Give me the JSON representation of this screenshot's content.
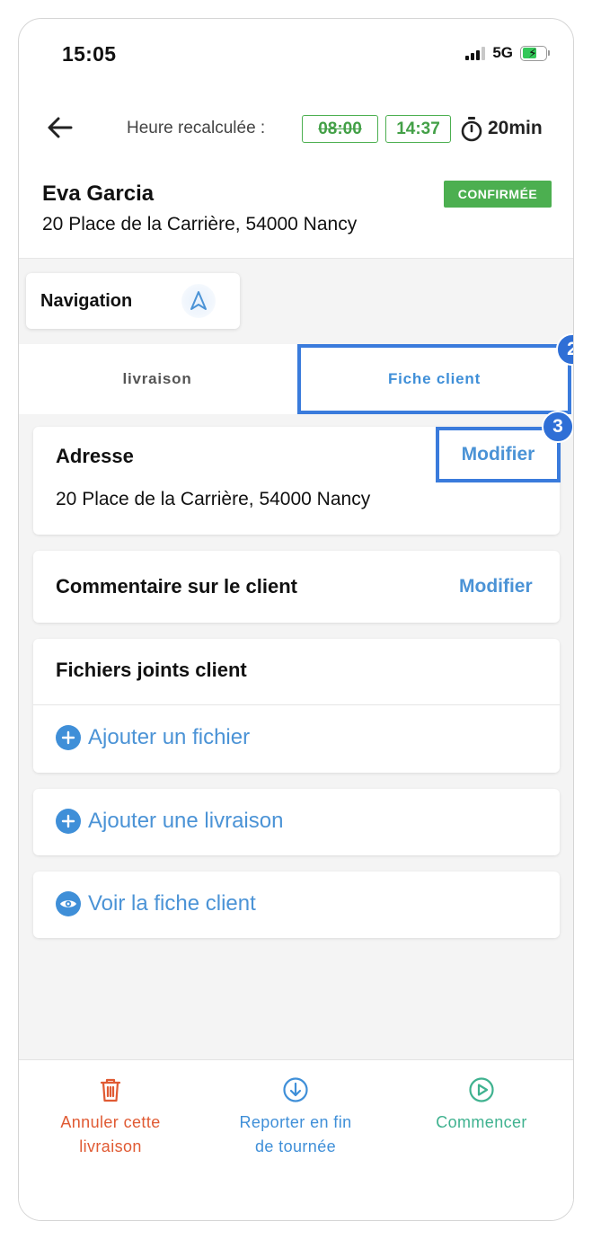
{
  "status_bar": {
    "time": "15:05",
    "network": "5G",
    "battery_level": 0.6
  },
  "header": {
    "back_icon": "arrow-left-icon",
    "recalc_label": "Heure recalculée :",
    "old_time": "08:00",
    "new_time": "14:37",
    "timer_icon": "stopwatch-icon",
    "duration": "20min"
  },
  "customer": {
    "name": "Eva Garcia",
    "address": "20 Place de la Carrière, 54000 Nancy",
    "status": "CONFIRMÉE"
  },
  "navigation": {
    "label": "Navigation",
    "icon": "navigation-arrow-icon"
  },
  "tabs": [
    {
      "label": "livraison",
      "active": false
    },
    {
      "label": "Fiche client",
      "active": true
    }
  ],
  "annotations": {
    "tab_step": "2",
    "modify_step": "3"
  },
  "cards": {
    "address": {
      "title": "Adresse",
      "value": "20 Place de la Carrière, 54000 Nancy",
      "action": "Modifier"
    },
    "comment": {
      "title": "Commentaire sur le client",
      "action": "Modifier"
    },
    "files": {
      "title": "Fichiers joints client",
      "add_label": "Ajouter un fichier",
      "add_icon": "plus-circle-icon"
    },
    "add_delivery": {
      "label": "Ajouter une livraison",
      "icon": "plus-circle-icon"
    },
    "view_client": {
      "label": "Voir la fiche client",
      "icon": "eye-icon"
    }
  },
  "bottom_actions": [
    {
      "line1": "Annuler cette",
      "line2": "livraison",
      "icon": "trash-icon",
      "color": "#e05a33"
    },
    {
      "line1": "Reporter en fin",
      "line2": "de tournée",
      "icon": "arrow-down-circle-icon",
      "color": "#3f8fd8"
    },
    {
      "line1": "Commencer",
      "line2": "",
      "icon": "play-circle-icon",
      "color": "#3fb28f"
    }
  ],
  "colors": {
    "accent_blue": "#3f8fd8",
    "highlight_blue": "#3a7bdc",
    "success_green": "#4caf50",
    "danger_orange": "#e05a33",
    "start_teal": "#3fb28f"
  }
}
